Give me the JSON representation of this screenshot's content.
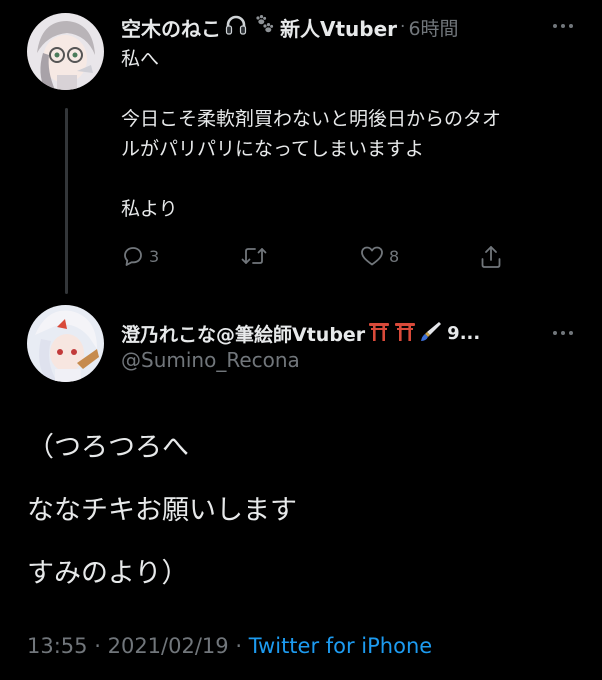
{
  "colors": {
    "background": "#000000",
    "text": "#e7e9ea",
    "muted": "#71767b",
    "link": "#1d9bf0",
    "thread_line": "#333639",
    "torii": "#d94a3a"
  },
  "parent_tweet": {
    "display_name": "空木のねこ",
    "display_name_suffix": "新人Vtuber",
    "name_emojis": [
      "headphones-emoji",
      "paw-prints-emoji"
    ],
    "separator": "·",
    "timestamp": "6時間",
    "lines": [
      "私へ",
      "",
      "今日こそ柔軟剤買わないと明後日からのタオ",
      "ルがパリパリになってしまいますよ",
      "",
      "私より"
    ],
    "reply_count": "3",
    "retweet_count": "",
    "like_count": "8"
  },
  "main_tweet": {
    "display_name": "澄乃れこな@筆絵師Vtuber",
    "name_emojis": [
      "torii-emoji",
      "torii-emoji",
      "brush-emoji"
    ],
    "name_tail": "9...",
    "handle": "@Sumino_Recona",
    "lines": [
      "（つろつろへ",
      "ななチキお願いします",
      "すみのより）"
    ],
    "time": "13:55",
    "separator": "·",
    "date": "2021/02/19",
    "separator2": "·",
    "source": "Twitter for iPhone"
  }
}
